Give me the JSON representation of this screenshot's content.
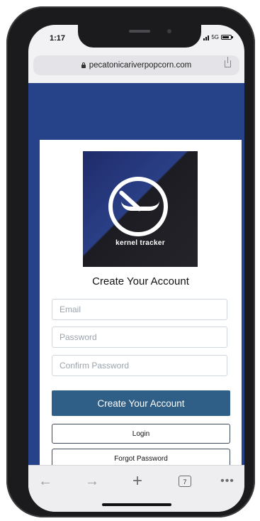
{
  "status_bar": {
    "time": "1:17",
    "network": "5G"
  },
  "browser": {
    "url": "pecatonicariverpopcorn.com"
  },
  "page": {
    "logo_text": "kernel tracker",
    "form_title": "Create Your Account",
    "fields": {
      "email_placeholder": "Email",
      "password_placeholder": "Password",
      "confirm_password_placeholder": "Confirm Password"
    },
    "buttons": {
      "create_account": "Create Your Account",
      "login": "Login",
      "forgot_password": "Forgot Password"
    }
  },
  "toolbar": {
    "back_icon": "←",
    "forward_icon": "→",
    "new_tab_icon": "+",
    "tab_count": "7",
    "more_icon": "•••"
  },
  "colors": {
    "page_background": "#26438a",
    "primary_button": "#2f5f86"
  }
}
